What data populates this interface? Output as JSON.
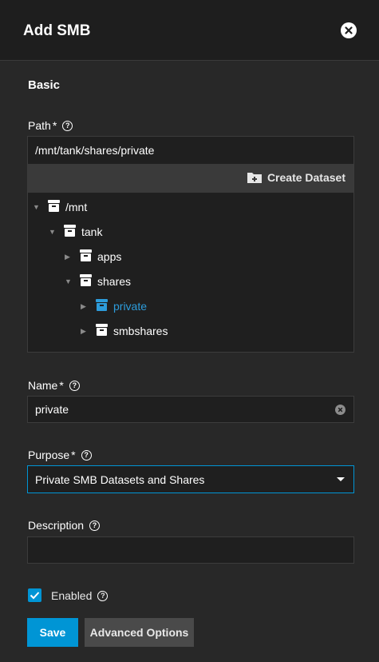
{
  "header": {
    "title": "Add SMB",
    "close_icon": "close-icon"
  },
  "section": {
    "title": "Basic"
  },
  "path": {
    "label": "Path",
    "required_mark": "*",
    "value": "/mnt/tank/shares/private",
    "create_dataset_label": "Create Dataset",
    "tree": [
      {
        "label": "/mnt",
        "expanded": true,
        "selected": false
      },
      {
        "label": "tank",
        "expanded": true,
        "selected": false
      },
      {
        "label": "apps",
        "expanded": false,
        "selected": false
      },
      {
        "label": "shares",
        "expanded": true,
        "selected": false
      },
      {
        "label": "private",
        "expanded": false,
        "selected": true
      },
      {
        "label": "smbshares",
        "expanded": false,
        "selected": false
      }
    ]
  },
  "name": {
    "label": "Name",
    "required_mark": "*",
    "value": "private"
  },
  "purpose": {
    "label": "Purpose",
    "required_mark": "*",
    "value": "Private SMB Datasets and Shares"
  },
  "description": {
    "label": "Description",
    "value": ""
  },
  "enabled": {
    "label": "Enabled",
    "checked": true
  },
  "buttons": {
    "save": "Save",
    "advanced": "Advanced Options"
  },
  "colors": {
    "accent": "#0095d5",
    "selected_node": "#2d9cdb",
    "background": "#282828",
    "header": "#1e1e1e"
  }
}
